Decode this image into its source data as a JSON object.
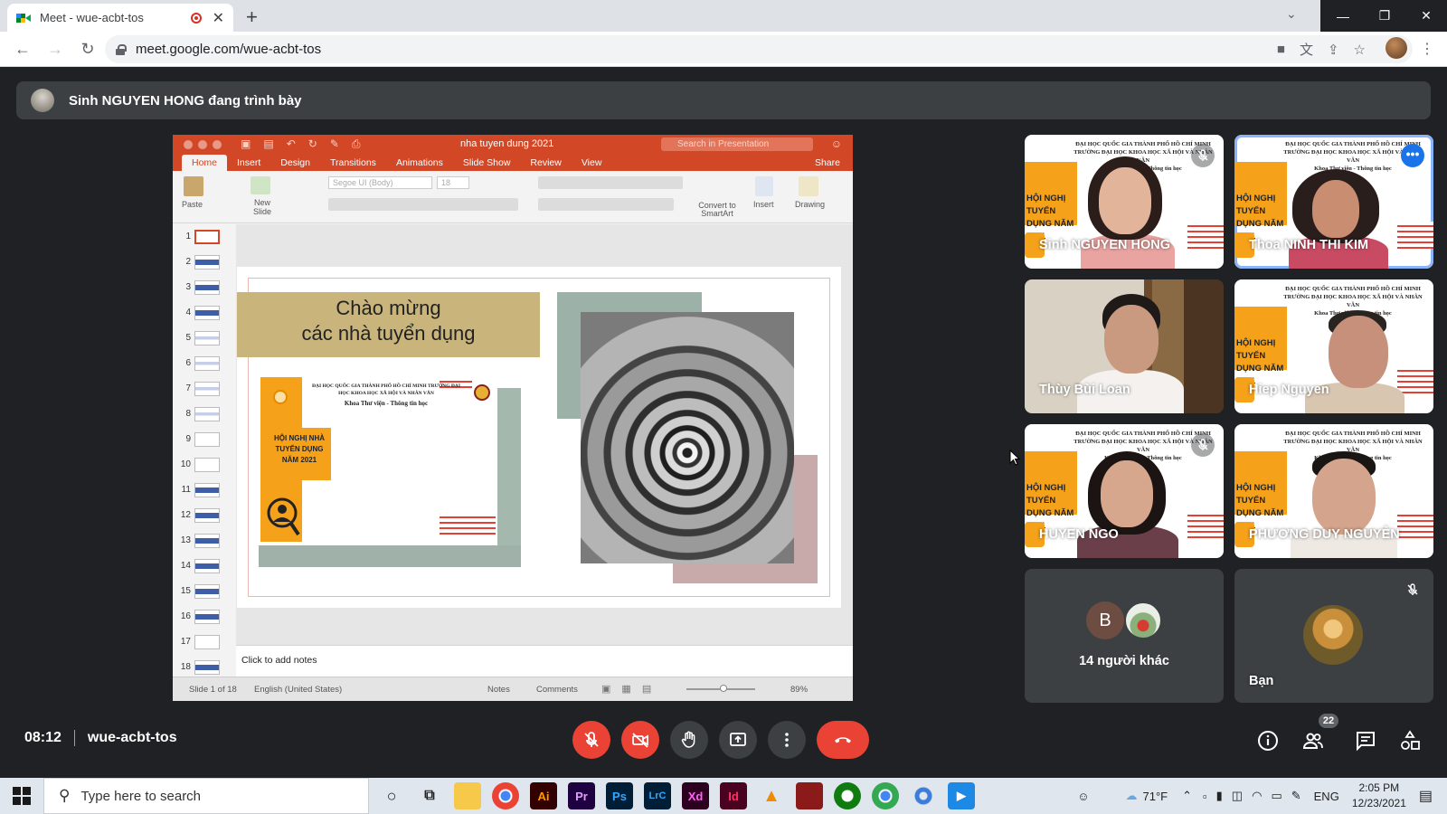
{
  "browser": {
    "tab_title": "Meet - wue-acbt-tos",
    "url": "meet.google.com/wue-acbt-tos"
  },
  "banner": {
    "presenting_text": "Sinh NGUYEN HONG đang trình bày"
  },
  "powerpoint": {
    "doc_title": "nha tuyen dung 2021",
    "search_placeholder": "Search in Presentation",
    "tabs": [
      "Home",
      "Insert",
      "Design",
      "Transitions",
      "Animations",
      "Slide Show",
      "Review",
      "View"
    ],
    "share_label": "Share",
    "ribbon": {
      "paste": "Paste",
      "new_slide": "New Slide",
      "font": "Segoe UI (Body)",
      "size": "18",
      "convert_smartart": "Convert to SmartArt",
      "insert": "Insert",
      "drawing": "Drawing"
    },
    "slide_numbers": [
      "1",
      "2",
      "3",
      "4",
      "5",
      "6",
      "7",
      "8",
      "9",
      "10",
      "11",
      "12",
      "13",
      "14",
      "15",
      "16",
      "17",
      "18"
    ],
    "slide": {
      "title_line1": "Chào mừng",
      "title_line2": "các nhà tuyển dụng",
      "poster_header": "ĐẠI HỌC QUỐC GIA THÀNH PHỐ HỒ CHÍ MINH TRƯỜNG ĐẠI HỌC KHOA HỌC XÃ HỘI VÀ NHÂN VĂN",
      "poster_dept": "Khoa Thư viện - Thông tin học",
      "poster_event": "HỘI NGHỊ NHÀ TUYỂN DỤNG NĂM 2021"
    },
    "notes_placeholder": "Click to add notes",
    "status": {
      "slide_of": "Slide 1 of 18",
      "language": "English (United States)",
      "notes": "Notes",
      "comments": "Comments",
      "zoom": "89%"
    }
  },
  "participants": [
    {
      "name": "Sinh NGUYEN HONG",
      "muted": true
    },
    {
      "name": "Thoa NINH THI KIM",
      "muted": false
    },
    {
      "name": "Thùy Bùi Loan",
      "muted": false
    },
    {
      "name": "Hiep Nguyen",
      "muted": false
    },
    {
      "name": "HUYEN NGO",
      "muted": true
    },
    {
      "name": "PHƯƠNG DUY NGUYỄN",
      "muted": false
    }
  ],
  "tile_poster": {
    "header": "ĐẠI HỌC QUỐC GIA THÀNH PHỐ HỒ CHÍ MINH TRƯỜNG ĐẠI HỌC KHOA HỌC XÃ HỘI VÀ NHÂN VĂN",
    "dept": "Khoa Thư viện - Thông tin học",
    "event": "HỘI NGHỊ TUYỂN DỤNG NĂM 2021"
  },
  "others": {
    "initial": "B",
    "label": "14 người khác"
  },
  "self_tile": {
    "name": "Bạn"
  },
  "meeting": {
    "time": "08:12",
    "code": "wue-acbt-tos",
    "participant_count": "22"
  },
  "taskbar": {
    "search_placeholder": "Type here to search",
    "weather": "71°F",
    "lang": "ENG",
    "time": "2:05 PM",
    "date": "12/23/2021",
    "apps": [
      "Ai",
      "Pr",
      "Ps",
      "LrC",
      "Xd",
      "Id"
    ]
  },
  "colors": {
    "meet_bg": "#202124",
    "end_call_red": "#ea4335",
    "ppt_orange": "#d24726"
  }
}
